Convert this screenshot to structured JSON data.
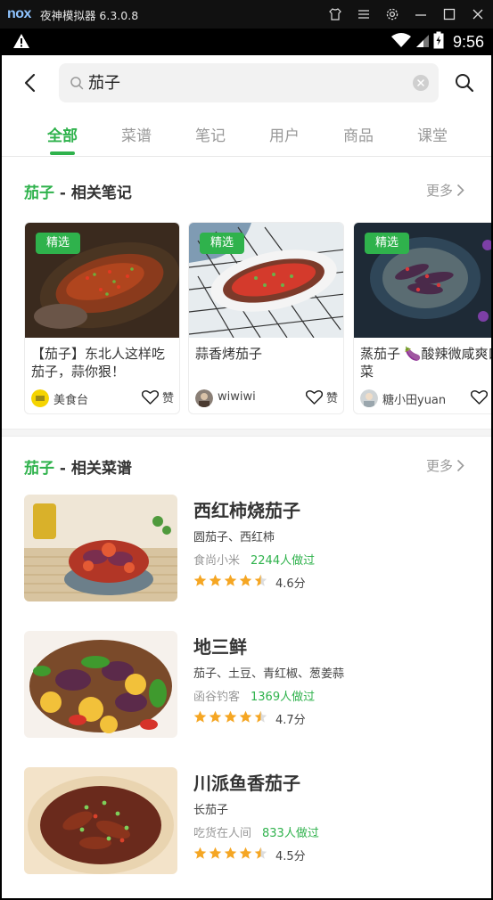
{
  "emulator": {
    "logo": "nox",
    "title": "夜神模拟器 6.3.0.8",
    "controls": [
      "shirt-icon",
      "menu-icon",
      "gear-icon",
      "minimize-icon",
      "maximize-icon",
      "close-icon"
    ]
  },
  "status_bar": {
    "time": "9:56",
    "icons": [
      "warning-icon",
      "wifi-icon",
      "signal-icon",
      "battery-icon"
    ]
  },
  "search": {
    "query": "茄子"
  },
  "tabs": [
    "全部",
    "菜谱",
    "笔记",
    "用户",
    "商品",
    "课堂"
  ],
  "active_tab_index": 0,
  "colors": {
    "accent": "#2fb24c",
    "muted": "#999999",
    "text": "#333333"
  },
  "notes_section": {
    "keyword": "茄子",
    "title_suffix": " - 相关笔记",
    "more_label": "更多",
    "cards": [
      {
        "badge": "精选",
        "title": "【茄子】东北人这样吃茄子，蒜你狠！",
        "author": "美食台",
        "like_label": "赞"
      },
      {
        "badge": "精选",
        "title": "蒜香烤茄子",
        "author": "wiwiwi",
        "like_label": "赞"
      },
      {
        "badge": "精选",
        "title": "蒸茄子 🍆酸辣微咸爽口菜",
        "author": "糖小田yuan",
        "like_label": "赞"
      }
    ]
  },
  "recipes_section": {
    "keyword": "茄子",
    "title_suffix": " - 相关菜谱",
    "more_label": "更多",
    "items": [
      {
        "title": "西红柿烧茄子",
        "ingredients": "圆茄子、西红柿",
        "author": "食尚小米",
        "cooked": "2244人做过",
        "rating": 4.6,
        "score_label": "4.6分"
      },
      {
        "title": "地三鲜",
        "ingredients": "茄子、土豆、青红椒、葱姜蒜",
        "author": "函谷钓客",
        "cooked": "1369人做过",
        "rating": 4.7,
        "score_label": "4.7分"
      },
      {
        "title": "川派鱼香茄子",
        "ingredients": "长茄子",
        "author": "吃货在人间",
        "cooked": "833人做过",
        "rating": 4.5,
        "score_label": "4.5分"
      }
    ]
  }
}
